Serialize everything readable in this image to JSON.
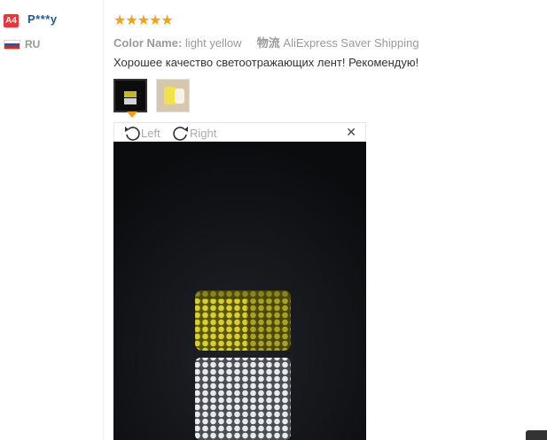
{
  "reviewer": {
    "level_badge": "A4",
    "name": "P***y",
    "country": "RU"
  },
  "rating": {
    "stars": "★★★★★",
    "value": 5,
    "max": 5
  },
  "order": {
    "color_label": "Color Name:",
    "color_value": "light yellow",
    "shipping_label": "物流",
    "shipping_value": "AliExpress Saver Shipping"
  },
  "review": {
    "text": "Хорошее качество светоотражающих лент! Рекомендую!"
  },
  "viewer": {
    "rotate_left_label": "Left",
    "rotate_right_label": "Right",
    "close_symbol": "✕"
  },
  "colors": {
    "accent_orange": "#f39c12",
    "star": "#f7a211",
    "username": "#1b5c9e",
    "badge": "#e4393c"
  }
}
